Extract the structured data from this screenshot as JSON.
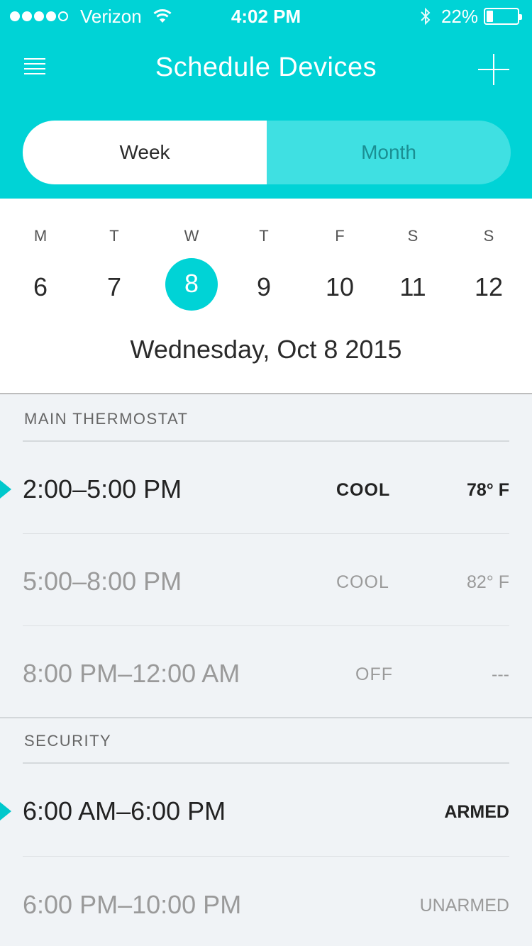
{
  "status_bar": {
    "carrier": "Verizon",
    "time": "4:02 PM",
    "battery_percent": "22%",
    "battery_level": 0.22,
    "signal_bars": 4
  },
  "nav": {
    "title": "Schedule Devices"
  },
  "segment": {
    "week": "Week",
    "month": "Month",
    "selected": "week"
  },
  "calendar": {
    "days": [
      {
        "letter": "M",
        "num": "6"
      },
      {
        "letter": "T",
        "num": "7"
      },
      {
        "letter": "W",
        "num": "8"
      },
      {
        "letter": "T",
        "num": "9"
      },
      {
        "letter": "F",
        "num": "10"
      },
      {
        "letter": "S",
        "num": "11"
      },
      {
        "letter": "S",
        "num": "12"
      }
    ],
    "selected_index": 2,
    "full_date": "Wednesday, Oct 8 2015"
  },
  "thermostat": {
    "title": "MAIN THERMOSTAT",
    "rows": [
      {
        "time": "2:00–5:00 PM",
        "mode": "COOL",
        "temp": "78° F"
      },
      {
        "time": "5:00–8:00 PM",
        "mode": "COOL",
        "temp": "82° F"
      },
      {
        "time": "8:00 PM–12:00 AM",
        "mode": "OFF",
        "temp": "---"
      }
    ]
  },
  "security": {
    "title": "SECURITY",
    "rows": [
      {
        "time": "6:00 AM–6:00 PM",
        "mode": "ARMED"
      },
      {
        "time": "6:00 PM–10:00 PM",
        "mode": "UNARMED"
      }
    ]
  },
  "colors": {
    "accent": "#00d3d6",
    "segment_inactive": "#3fe0e2",
    "background": "#f0f3f6"
  }
}
